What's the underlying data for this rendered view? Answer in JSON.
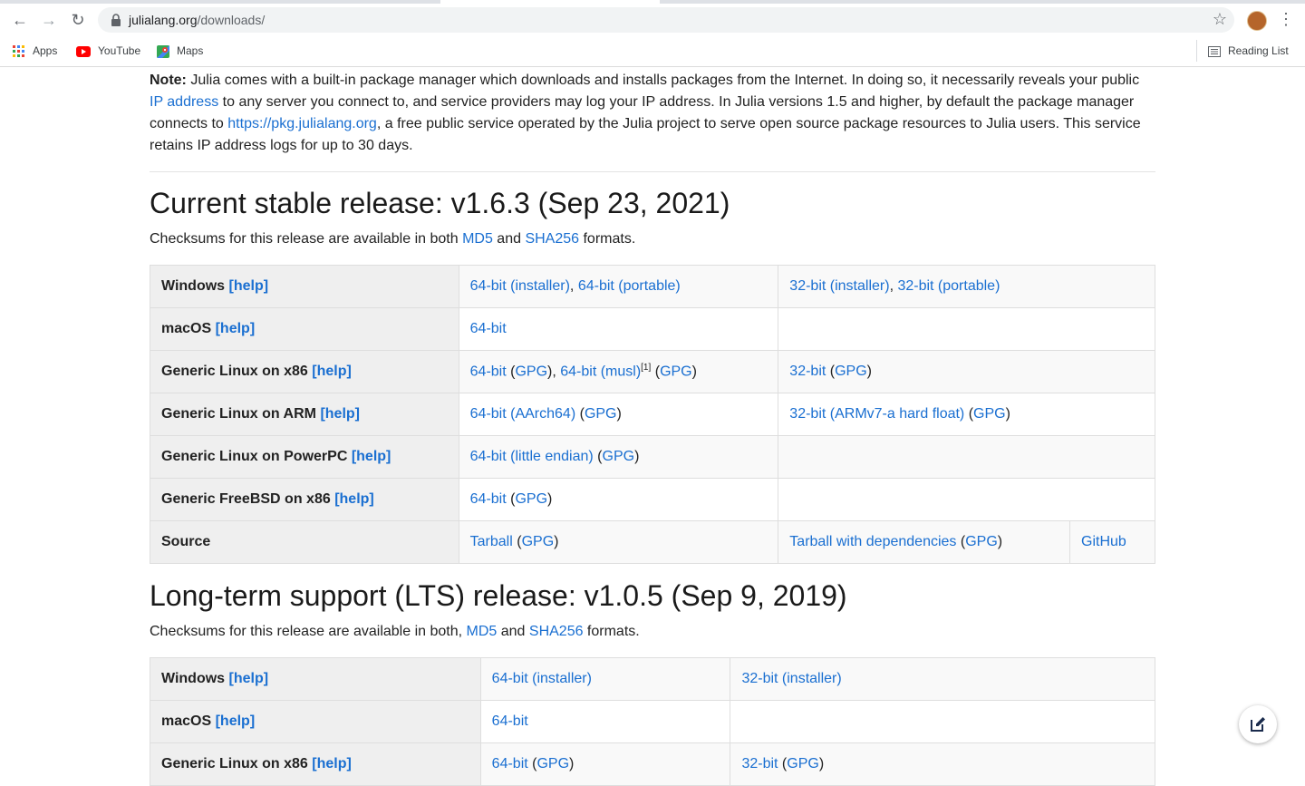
{
  "browser": {
    "url_host": "julialang.org",
    "url_path": "/downloads/",
    "bookmarks": [
      "Apps",
      "YouTube",
      "Maps"
    ],
    "reading_list": "Reading List"
  },
  "note": {
    "label": "Note:",
    "text1": " Julia comes with a built-in package manager which downloads and installs packages from the Internet. In doing so, it necessarily reveals your public ",
    "link1": "IP address",
    "text2": " to any server you connect to, and service providers may log your IP address. In Julia versions 1.5 and higher, by default the package manager connects to ",
    "link2": "https://pkg.julialang.org",
    "text3": ", a free public service operated by the Julia project to serve open source package resources to Julia users. This service retains IP address logs for up to 30 days."
  },
  "stable": {
    "heading": "Current stable release: v1.6.3 (Sep 23, 2021)",
    "checksums": {
      "pre": "Checksums for this release are available in both ",
      "md5": "MD5",
      "and": " and ",
      "sha": "SHA256",
      "post": " formats."
    },
    "help": "[help]",
    "rows": {
      "windows": {
        "os": "Windows",
        "c1a": "64-bit (installer)",
        "c1b": "64-bit (portable)",
        "c2a": "32-bit (installer)",
        "c2b": "32-bit (portable)"
      },
      "macos": {
        "os": "macOS",
        "c1a": "64-bit"
      },
      "linux_x86": {
        "os": "Generic Linux on x86",
        "c1a": "64-bit",
        "c1a_gpg": "GPG",
        "c1b": "64-bit (musl)",
        "c1b_sup": "[1]",
        "c1b_gpg": "GPG",
        "c2a": "32-bit",
        "c2a_gpg": "GPG"
      },
      "linux_arm": {
        "os": "Generic Linux on ARM",
        "c1a": "64-bit (AArch64)",
        "c1a_gpg": "GPG",
        "c2a": "32-bit (ARMv7-a hard float)",
        "c2a_gpg": "GPG"
      },
      "linux_ppc": {
        "os": "Generic Linux on PowerPC",
        "c1a": "64-bit (little endian)",
        "c1a_gpg": "GPG"
      },
      "freebsd": {
        "os": "Generic FreeBSD on x86",
        "c1a": "64-bit",
        "c1a_gpg": "GPG"
      },
      "source": {
        "os": "Source",
        "c1a": "Tarball",
        "c1a_gpg": "GPG",
        "c2a": "Tarball with dependencies",
        "c2a_gpg": "GPG",
        "c3": "GitHub"
      }
    }
  },
  "lts": {
    "heading": "Long-term support (LTS) release: v1.0.5 (Sep 9, 2019)",
    "checksums": {
      "pre": "Checksums for this release are available in both, ",
      "md5": "MD5",
      "and": " and ",
      "sha": "SHA256",
      "post": " formats."
    },
    "help": "[help]",
    "rows": {
      "windows": {
        "os": "Windows",
        "c1a": "64-bit (installer)",
        "c2a": "32-bit (installer)"
      },
      "macos": {
        "os": "macOS",
        "c1a": "64-bit"
      },
      "linux_x86": {
        "os": "Generic Linux on x86",
        "c1a": "64-bit",
        "c1a_gpg": "GPG",
        "c2a": "32-bit",
        "c2a_gpg": "GPG"
      }
    }
  }
}
